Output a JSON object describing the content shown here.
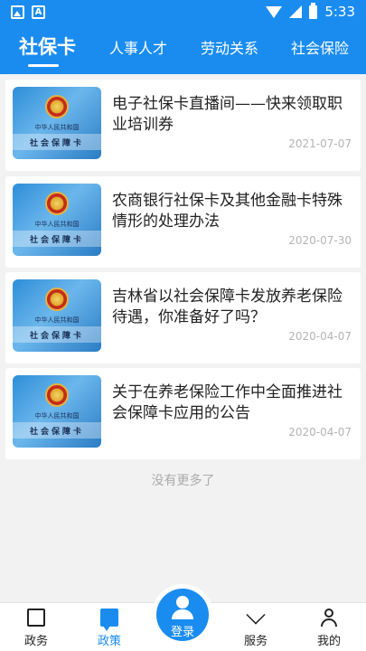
{
  "status_bar": {
    "time": "5:33",
    "left_icons": [
      "image-icon",
      "a-icon"
    ],
    "right_icons": [
      "wifi-icon",
      "signal-icon",
      "battery-icon"
    ]
  },
  "colors": {
    "accent": "#1a8cf0",
    "card_bg": "#ffffff",
    "page_bg": "#f2f2f2",
    "date": "#b4b4b4"
  },
  "tabs": [
    {
      "label": "社保卡",
      "active": true
    },
    {
      "label": "人事人才",
      "active": false
    },
    {
      "label": "劳动关系",
      "active": false
    },
    {
      "label": "社会保险",
      "active": false
    }
  ],
  "thumb": {
    "subtitle": "中华人民共和国",
    "main": "社会保障卡"
  },
  "articles": [
    {
      "title": "电子社保卡直播间——快来领取职业培训券",
      "date": "2021-07-07"
    },
    {
      "title": "农商银行社保卡及其他金融卡特殊情形的处理办法",
      "date": "2020-07-30"
    },
    {
      "title": "吉林省以社会保障卡发放养老保险待遇，你准备好了吗？",
      "date": "2020-04-07"
    },
    {
      "title": "关于在养老保险工作中全面推进社会保障卡应用的公告",
      "date": "2020-04-07"
    }
  ],
  "no_more": "没有更多了",
  "bottom_nav": [
    {
      "label": "政务",
      "icon": "square-icon",
      "active": false
    },
    {
      "label": "政策",
      "icon": "chat-icon",
      "active": true
    },
    {
      "label": "登录",
      "icon": "user-icon",
      "active": false
    },
    {
      "label": "服务",
      "icon": "heart-icon",
      "active": false
    },
    {
      "label": "我的",
      "icon": "person-icon",
      "active": false
    }
  ]
}
